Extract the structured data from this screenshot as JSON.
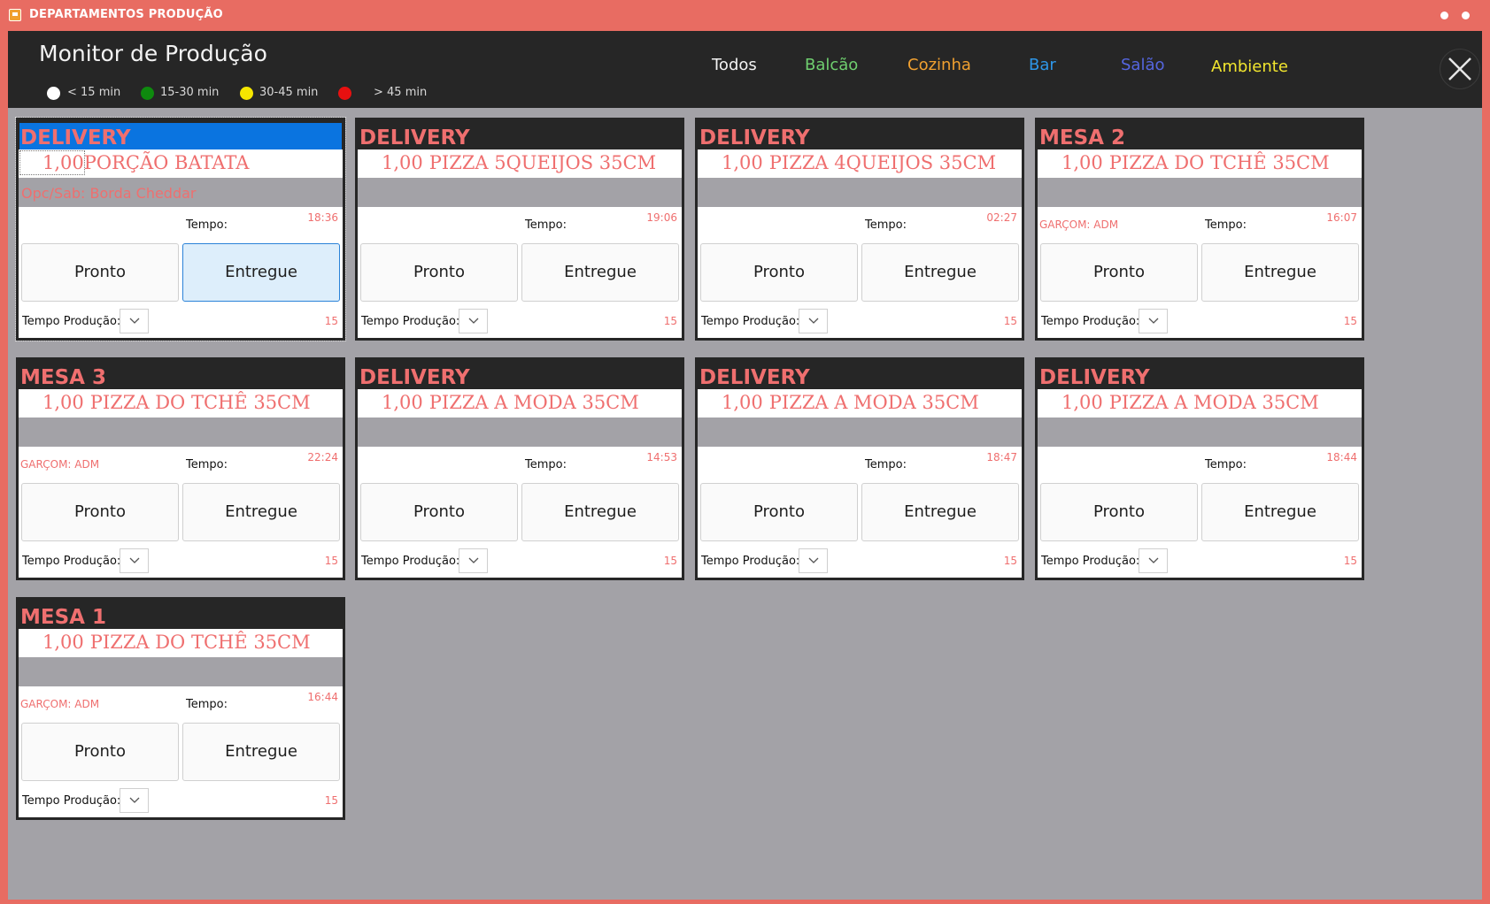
{
  "window": {
    "title": "DEPARTAMENTOS PRODUÇÃO"
  },
  "header": {
    "title": "Monitor de Produção",
    "legend": [
      {
        "color": "#ffffff",
        "label": "< 15 min"
      },
      {
        "color": "#0e8a0e",
        "label": "15-30 min"
      },
      {
        "color": "#f5e600",
        "label": "30-45 min"
      },
      {
        "color": "#e81010",
        "label": "> 45 min"
      }
    ],
    "filters": [
      {
        "label": "Todos",
        "color": "#f2f2f2"
      },
      {
        "label": "Balcão",
        "color": "#6fcf6f"
      },
      {
        "label": "Cozinha",
        "color": "#f0a030"
      },
      {
        "label": "Bar",
        "color": "#2e96e8"
      },
      {
        "label": "Salão",
        "color": "#5566e0"
      },
      {
        "label": "Ambiente",
        "color": "#f2e62e"
      }
    ]
  },
  "labels": {
    "tempo": "Tempo:",
    "pronto": "Pronto",
    "entregue": "Entregue",
    "tempo_producao": "Tempo Produção:"
  },
  "cards": [
    {
      "title": "DELIVERY",
      "qty": "1,00",
      "item": "PORÇÃO BATATA",
      "opc": "Opc/Sab: Borda Cheddar",
      "waiter": "",
      "time": "18:36",
      "prod": "15"
    },
    {
      "title": "DELIVERY",
      "qty": "1,00",
      "item": "PIZZA 5QUEIJOS 35CM",
      "opc": "",
      "waiter": "",
      "time": "19:06",
      "prod": "15"
    },
    {
      "title": "DELIVERY",
      "qty": "1,00",
      "item": "PIZZA 4QUEIJOS 35CM",
      "opc": "",
      "waiter": "",
      "time": "02:27",
      "prod": "15"
    },
    {
      "title": "MESA 2",
      "qty": "1,00",
      "item": "PIZZA DO TCHÊ 35CM",
      "opc": "",
      "waiter": "GARÇOM: ADM",
      "time": "16:07",
      "prod": "15"
    },
    {
      "title": "MESA 3",
      "qty": "1,00",
      "item": "PIZZA DO TCHÊ 35CM",
      "opc": "",
      "waiter": "GARÇOM: ADM",
      "time": "22:24",
      "prod": "15"
    },
    {
      "title": "DELIVERY",
      "qty": "1,00",
      "item": "PIZZA A MODA 35CM",
      "opc": "",
      "waiter": "",
      "time": "14:53",
      "prod": "15"
    },
    {
      "title": "DELIVERY",
      "qty": "1,00",
      "item": "PIZZA A MODA 35CM",
      "opc": "",
      "waiter": "",
      "time": "18:47",
      "prod": "15"
    },
    {
      "title": "DELIVERY",
      "qty": "1,00",
      "item": "PIZZA A MODA 35CM",
      "opc": "",
      "waiter": "",
      "time": "18:44",
      "prod": "15"
    },
    {
      "title": "MESA 1",
      "qty": "1,00",
      "item": "PIZZA DO TCHÊ 35CM",
      "opc": "",
      "waiter": "GARÇOM: ADM",
      "time": "16:44",
      "prod": "15"
    }
  ]
}
